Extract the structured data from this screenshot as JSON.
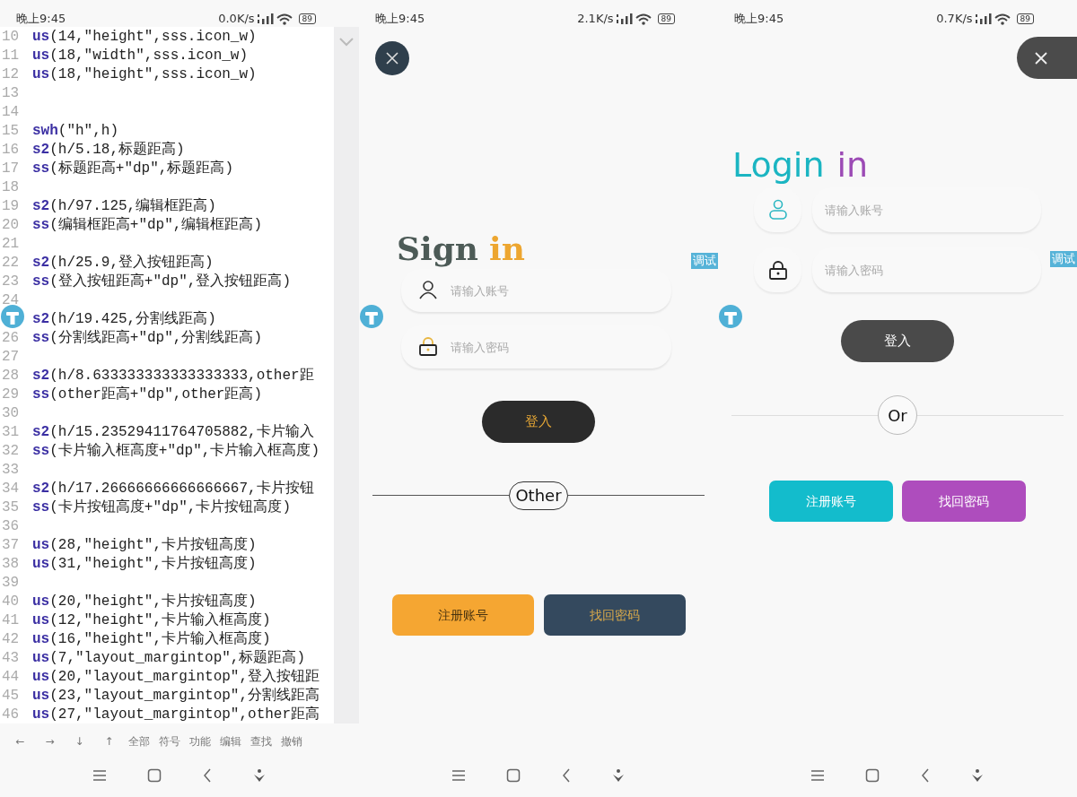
{
  "editor": {
    "status_bar": {
      "time": "晚上9:45",
      "speed": "0.0K/s",
      "battery": "89"
    },
    "code_lines": [
      {
        "number": "10",
        "function": "us",
        "args": "(14,\"height\",sss.icon_w)"
      },
      {
        "number": "11",
        "function": "us",
        "args": "(18,\"width\",sss.icon_w)"
      },
      {
        "number": "12",
        "function": "us",
        "args": "(18,\"height\",sss.icon_w)"
      },
      {
        "number": "13"
      },
      {
        "number": "14"
      },
      {
        "number": "15",
        "function": "swh",
        "args": "(\"h\",h)"
      },
      {
        "number": "16",
        "function": "s2",
        "args": "(h/5.18,标题距高)"
      },
      {
        "number": "17",
        "function": "ss",
        "args": "(标题距高+\"dp\",标题距高)"
      },
      {
        "number": "18"
      },
      {
        "number": "19",
        "function": "s2",
        "args": "(h/97.125,编辑框距高)"
      },
      {
        "number": "20",
        "function": "ss",
        "args": "(编辑框距高+\"dp\",编辑框距高)"
      },
      {
        "number": "21"
      },
      {
        "number": "22",
        "function": "s2",
        "args": "(h/25.9,登入按钮距高)"
      },
      {
        "number": "23",
        "function": "ss",
        "args": "(登入按钮距高+\"dp\",登入按钮距高)"
      },
      {
        "number": "24"
      },
      {
        "function": "s2",
        "args": "(h/19.425,分割线距高)"
      },
      {
        "number": "26",
        "function": "ss",
        "args": "(分割线距高+\"dp\",分割线距高)"
      },
      {
        "number": "27"
      },
      {
        "number": "28",
        "function": "s2",
        "args": "(h/8.633333333333333333,other距"
      },
      {
        "number": "29",
        "function": "ss",
        "args": "(other距高+\"dp\",other距高)"
      },
      {
        "number": "30"
      },
      {
        "number": "31",
        "function": "s2",
        "args": "(h/15.23529411764705882,卡片输入"
      },
      {
        "number": "32",
        "function": "ss",
        "args": "(卡片输入框高度+\"dp\",卡片输入框高度)"
      },
      {
        "number": "33"
      },
      {
        "number": "34",
        "function": "s2",
        "args": "(h/17.26666666666666667,卡片按钮"
      },
      {
        "number": "35",
        "function": "ss",
        "args": "(卡片按钮高度+\"dp\",卡片按钮高度)"
      },
      {
        "number": "36"
      },
      {
        "number": "37",
        "function": "us",
        "args": "(28,\"height\",卡片按钮高度)"
      },
      {
        "number": "38",
        "function": "us",
        "args": "(31,\"height\",卡片按钮高度)"
      },
      {
        "number": "39"
      },
      {
        "number": "40",
        "function": "us",
        "args": "(20,\"height\",卡片按钮高度)"
      },
      {
        "number": "41",
        "function": "us",
        "args": "(12,\"height\",卡片输入框高度)"
      },
      {
        "number": "42",
        "function": "us",
        "args": "(16,\"height\",卡片输入框高度)"
      },
      {
        "number": "43",
        "function": "us",
        "args": "(7,\"layout_margintop\",标题距高)"
      },
      {
        "number": "44",
        "function": "us",
        "args": "(20,\"layout_margintop\",登入按钮距"
      },
      {
        "number": "45",
        "function": "us",
        "args": "(23,\"layout_margintop\",分割线距高"
      },
      {
        "number": "46",
        "function": "us",
        "args": "(27,\"layout_margintop\",other距高"
      }
    ],
    "toolbar": [
      "←",
      "→",
      "↓",
      "↑",
      "全部",
      "符号",
      "功能",
      "编辑",
      "查找",
      "撤销"
    ]
  },
  "screens": [
    {
      "kind": "serif",
      "status_bar": {
        "time": "晚上9:45",
        "speed": "2.1K/s",
        "battery": "89"
      },
      "title": [
        {
          "text": "Sign",
          "color": "#4d5b57"
        },
        {
          "text": "in",
          "color": "#eda630"
        }
      ],
      "debug_badge": "调试",
      "fields": [
        {
          "kind": "user",
          "placeholder": "请输入账号"
        },
        {
          "kind": "lock",
          "placeholder": "请输入密码"
        }
      ],
      "login_button": "登入",
      "divider_label": "Other",
      "buttons": [
        {
          "label": "注册账号",
          "color": "#f5a632"
        },
        {
          "label": "找回密码",
          "color": "#34495e"
        }
      ]
    },
    {
      "kind": "rounded",
      "status_bar": {
        "time": "晚上9:45",
        "speed": "0.7K/s",
        "battery": "89"
      },
      "title": [
        {
          "text": "Login",
          "color": "#1bb5c2"
        },
        {
          "text": "in",
          "color": "#9c4bb5"
        }
      ],
      "debug_badge": "调试",
      "fields": [
        {
          "kind": "user",
          "placeholder": "请输入账号"
        },
        {
          "kind": "lock",
          "placeholder": "请输入密码"
        }
      ],
      "login_button": "登入",
      "divider_label": "Or",
      "buttons": [
        {
          "label": "注册账号",
          "color": "#13bccc"
        },
        {
          "label": "找回密码",
          "color": "#ae4dbd"
        }
      ]
    }
  ]
}
